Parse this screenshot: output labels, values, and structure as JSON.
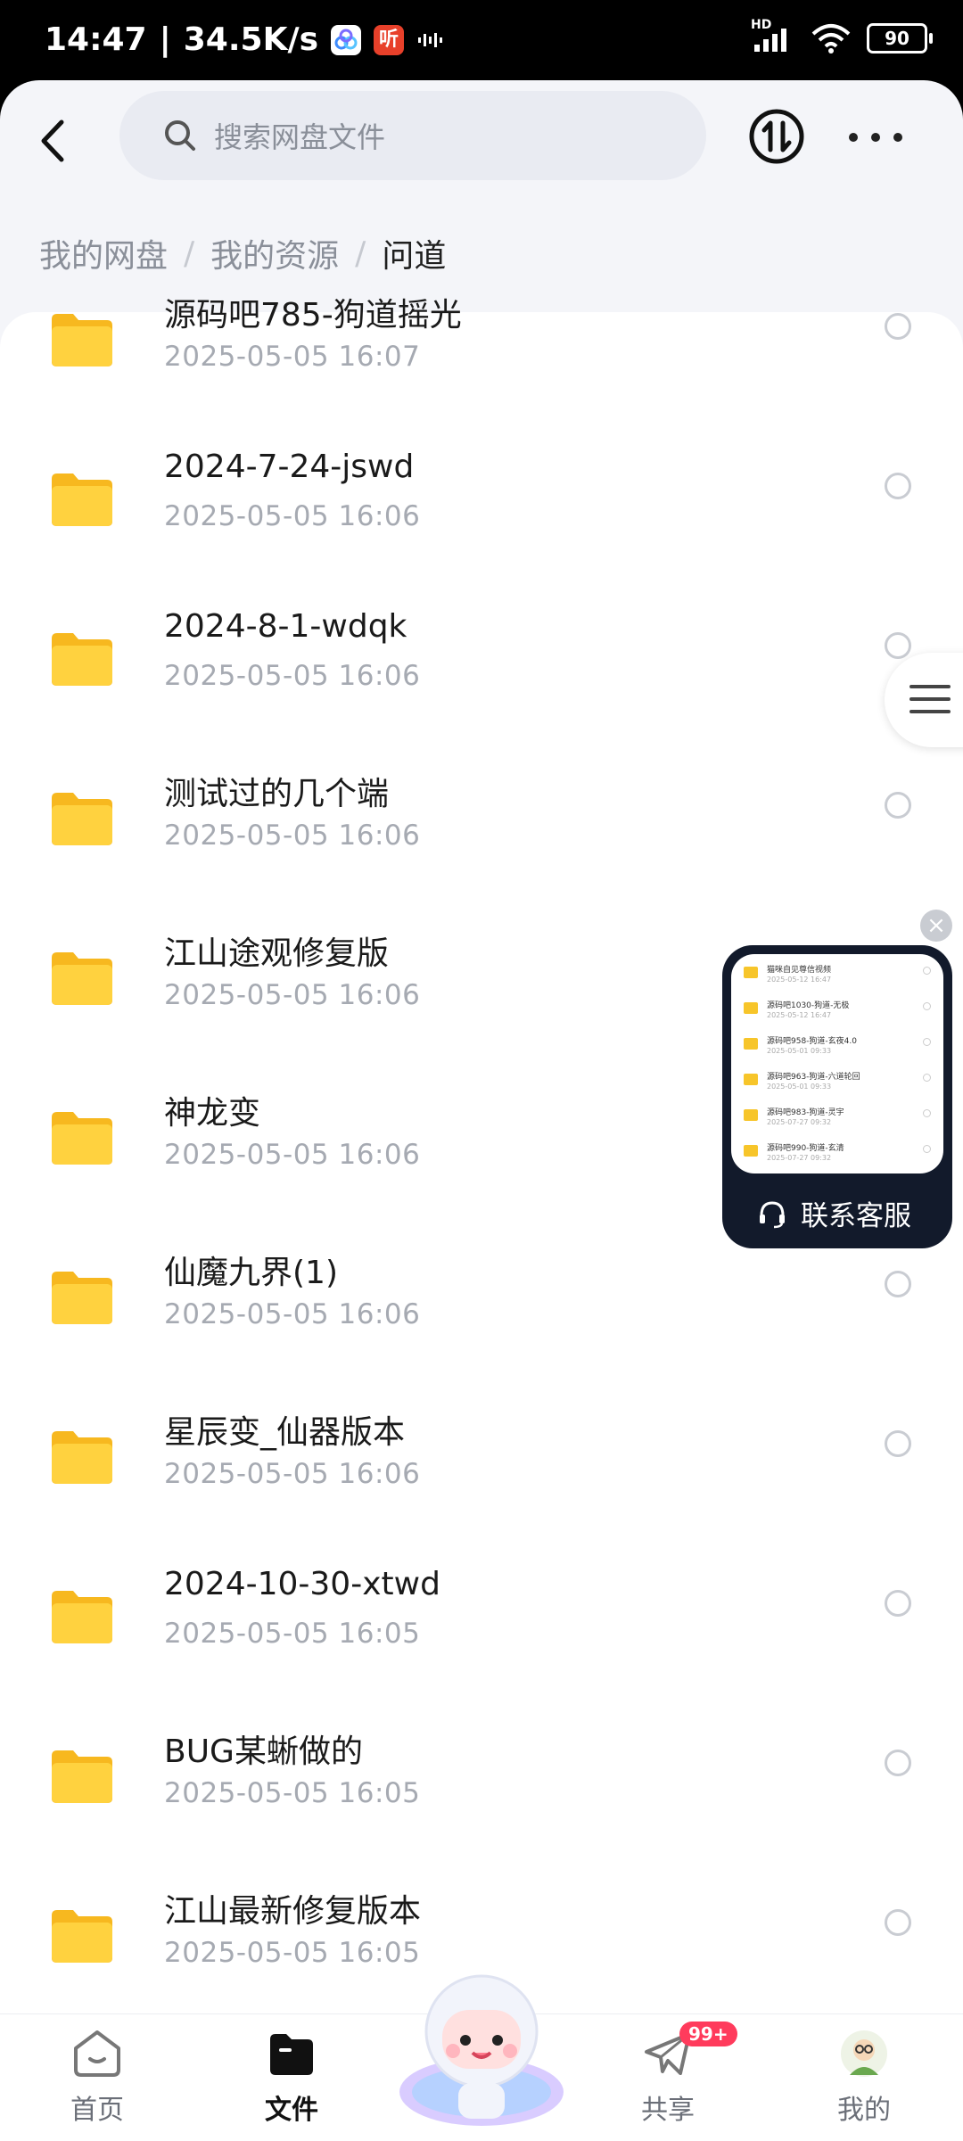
{
  "status_bar": {
    "time": "14:47",
    "net_speed": "34.5K/s",
    "app_badge": "听",
    "network": "HD",
    "battery": "90"
  },
  "header": {
    "search_placeholder": "搜索网盘文件"
  },
  "breadcrumb": [
    "我的网盘",
    "我的资源",
    "问道"
  ],
  "files": [
    {
      "name": "源码吧785-狗道摇光",
      "date": "2025-05-05  16:07"
    },
    {
      "name": "2024-7-24-jswd",
      "date": "2025-05-05  16:06"
    },
    {
      "name": "2024-8-1-wdqk",
      "date": "2025-05-05  16:06"
    },
    {
      "name": "测试过的几个端",
      "date": "2025-05-05  16:06"
    },
    {
      "name": "江山途观修复版",
      "date": "2025-05-05  16:06"
    },
    {
      "name": "神龙变",
      "date": "2025-05-05  16:06"
    },
    {
      "name": "仙魔九界(1)",
      "date": "2025-05-05  16:06"
    },
    {
      "name": "星辰变_仙器版本",
      "date": "2025-05-05  16:06"
    },
    {
      "name": "2024-10-30-xtwd",
      "date": "2025-05-05  16:05"
    },
    {
      "name": "BUG某蜥做的",
      "date": "2025-05-05  16:05"
    },
    {
      "name": "江山最新修复版本",
      "date": "2025-05-05  16:05"
    }
  ],
  "service_widget": {
    "label": "联系客服",
    "preview_rows": [
      {
        "name": "猫咪自见尊信视频",
        "date": "2025-05-12 16:47"
      },
      {
        "name": "源码吧1030-狗道-无极",
        "date": "2025-05-12 16:47"
      },
      {
        "name": "源码吧958-狗道-玄夜4.0",
        "date": "2025-05-01 09:33"
      },
      {
        "name": "源码吧963-狗道-六道轮回",
        "date": "2025-05-01 09:33"
      },
      {
        "name": "源码吧983-狗道-灵宇",
        "date": "2025-07-27 09:32"
      },
      {
        "name": "源码吧990-狗道-玄清",
        "date": "2025-07-27 09:32"
      }
    ]
  },
  "bottom_nav": {
    "home": "首页",
    "files": "文件",
    "share": "共享",
    "share_badge": "99+",
    "me": "我的"
  },
  "colors": {
    "folder": "#FFCB2E",
    "accent": "#111111",
    "badge": "#FF3B5C"
  }
}
